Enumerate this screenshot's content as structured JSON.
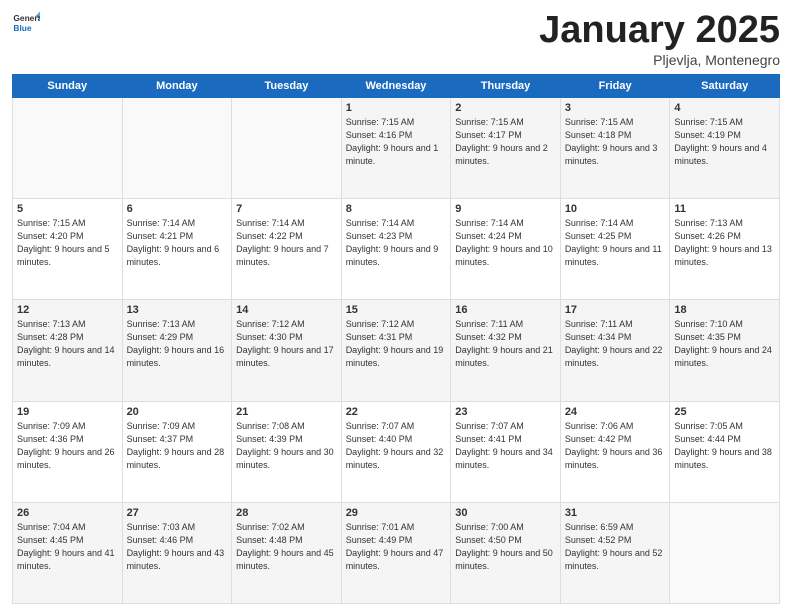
{
  "header": {
    "logo_general": "General",
    "logo_blue": "Blue",
    "title": "January 2025",
    "location": "Pljevlja, Montenegro"
  },
  "weekdays": [
    "Sunday",
    "Monday",
    "Tuesday",
    "Wednesday",
    "Thursday",
    "Friday",
    "Saturday"
  ],
  "weeks": [
    [
      {
        "day": "",
        "info": ""
      },
      {
        "day": "",
        "info": ""
      },
      {
        "day": "",
        "info": ""
      },
      {
        "day": "1",
        "info": "Sunrise: 7:15 AM\nSunset: 4:16 PM\nDaylight: 9 hours and 1 minute."
      },
      {
        "day": "2",
        "info": "Sunrise: 7:15 AM\nSunset: 4:17 PM\nDaylight: 9 hours and 2 minutes."
      },
      {
        "day": "3",
        "info": "Sunrise: 7:15 AM\nSunset: 4:18 PM\nDaylight: 9 hours and 3 minutes."
      },
      {
        "day": "4",
        "info": "Sunrise: 7:15 AM\nSunset: 4:19 PM\nDaylight: 9 hours and 4 minutes."
      }
    ],
    [
      {
        "day": "5",
        "info": "Sunrise: 7:15 AM\nSunset: 4:20 PM\nDaylight: 9 hours and 5 minutes."
      },
      {
        "day": "6",
        "info": "Sunrise: 7:14 AM\nSunset: 4:21 PM\nDaylight: 9 hours and 6 minutes."
      },
      {
        "day": "7",
        "info": "Sunrise: 7:14 AM\nSunset: 4:22 PM\nDaylight: 9 hours and 7 minutes."
      },
      {
        "day": "8",
        "info": "Sunrise: 7:14 AM\nSunset: 4:23 PM\nDaylight: 9 hours and 9 minutes."
      },
      {
        "day": "9",
        "info": "Sunrise: 7:14 AM\nSunset: 4:24 PM\nDaylight: 9 hours and 10 minutes."
      },
      {
        "day": "10",
        "info": "Sunrise: 7:14 AM\nSunset: 4:25 PM\nDaylight: 9 hours and 11 minutes."
      },
      {
        "day": "11",
        "info": "Sunrise: 7:13 AM\nSunset: 4:26 PM\nDaylight: 9 hours and 13 minutes."
      }
    ],
    [
      {
        "day": "12",
        "info": "Sunrise: 7:13 AM\nSunset: 4:28 PM\nDaylight: 9 hours and 14 minutes."
      },
      {
        "day": "13",
        "info": "Sunrise: 7:13 AM\nSunset: 4:29 PM\nDaylight: 9 hours and 16 minutes."
      },
      {
        "day": "14",
        "info": "Sunrise: 7:12 AM\nSunset: 4:30 PM\nDaylight: 9 hours and 17 minutes."
      },
      {
        "day": "15",
        "info": "Sunrise: 7:12 AM\nSunset: 4:31 PM\nDaylight: 9 hours and 19 minutes."
      },
      {
        "day": "16",
        "info": "Sunrise: 7:11 AM\nSunset: 4:32 PM\nDaylight: 9 hours and 21 minutes."
      },
      {
        "day": "17",
        "info": "Sunrise: 7:11 AM\nSunset: 4:34 PM\nDaylight: 9 hours and 22 minutes."
      },
      {
        "day": "18",
        "info": "Sunrise: 7:10 AM\nSunset: 4:35 PM\nDaylight: 9 hours and 24 minutes."
      }
    ],
    [
      {
        "day": "19",
        "info": "Sunrise: 7:09 AM\nSunset: 4:36 PM\nDaylight: 9 hours and 26 minutes."
      },
      {
        "day": "20",
        "info": "Sunrise: 7:09 AM\nSunset: 4:37 PM\nDaylight: 9 hours and 28 minutes."
      },
      {
        "day": "21",
        "info": "Sunrise: 7:08 AM\nSunset: 4:39 PM\nDaylight: 9 hours and 30 minutes."
      },
      {
        "day": "22",
        "info": "Sunrise: 7:07 AM\nSunset: 4:40 PM\nDaylight: 9 hours and 32 minutes."
      },
      {
        "day": "23",
        "info": "Sunrise: 7:07 AM\nSunset: 4:41 PM\nDaylight: 9 hours and 34 minutes."
      },
      {
        "day": "24",
        "info": "Sunrise: 7:06 AM\nSunset: 4:42 PM\nDaylight: 9 hours and 36 minutes."
      },
      {
        "day": "25",
        "info": "Sunrise: 7:05 AM\nSunset: 4:44 PM\nDaylight: 9 hours and 38 minutes."
      }
    ],
    [
      {
        "day": "26",
        "info": "Sunrise: 7:04 AM\nSunset: 4:45 PM\nDaylight: 9 hours and 41 minutes."
      },
      {
        "day": "27",
        "info": "Sunrise: 7:03 AM\nSunset: 4:46 PM\nDaylight: 9 hours and 43 minutes."
      },
      {
        "day": "28",
        "info": "Sunrise: 7:02 AM\nSunset: 4:48 PM\nDaylight: 9 hours and 45 minutes."
      },
      {
        "day": "29",
        "info": "Sunrise: 7:01 AM\nSunset: 4:49 PM\nDaylight: 9 hours and 47 minutes."
      },
      {
        "day": "30",
        "info": "Sunrise: 7:00 AM\nSunset: 4:50 PM\nDaylight: 9 hours and 50 minutes."
      },
      {
        "day": "31",
        "info": "Sunrise: 6:59 AM\nSunset: 4:52 PM\nDaylight: 9 hours and 52 minutes."
      },
      {
        "day": "",
        "info": ""
      }
    ]
  ]
}
